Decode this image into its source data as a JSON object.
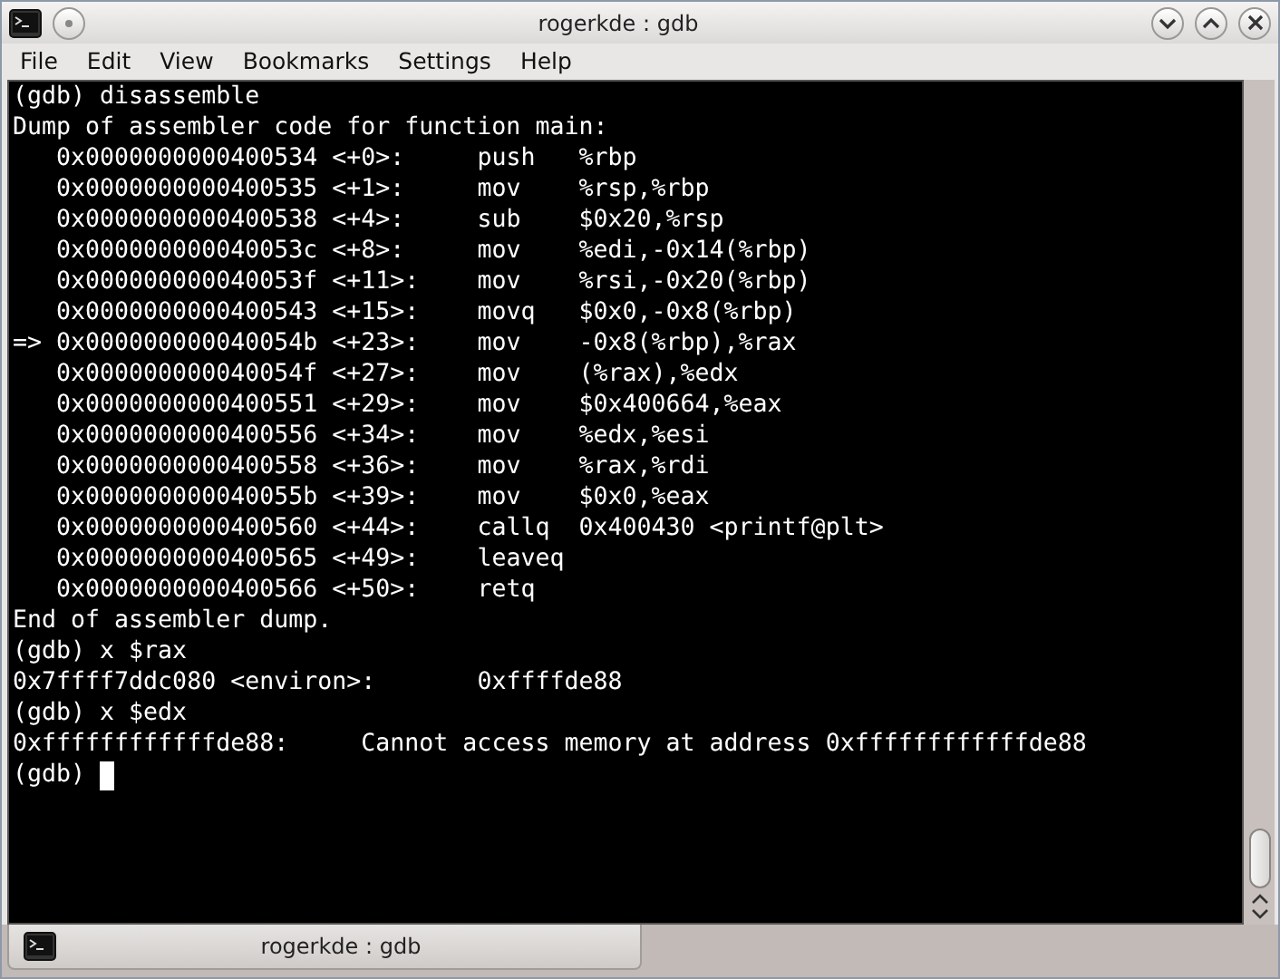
{
  "window": {
    "title": "rogerkde : gdb"
  },
  "menu": [
    "File",
    "Edit",
    "View",
    "Bookmarks",
    "Settings",
    "Help"
  ],
  "terminal": {
    "lines": [
      {
        "text": "(gdb) disassemble",
        "cursor": false
      },
      {
        "text": "Dump of assembler code for function main:",
        "cursor": false
      },
      {
        "text": "   0x0000000000400534 <+0>:\tpush   %rbp",
        "cursor": false
      },
      {
        "text": "   0x0000000000400535 <+1>:\tmov    %rsp,%rbp",
        "cursor": false
      },
      {
        "text": "   0x0000000000400538 <+4>:\tsub    $0x20,%rsp",
        "cursor": false
      },
      {
        "text": "   0x000000000040053c <+8>:\tmov    %edi,-0x14(%rbp)",
        "cursor": false
      },
      {
        "text": "   0x000000000040053f <+11>:\tmov    %rsi,-0x20(%rbp)",
        "cursor": false
      },
      {
        "text": "   0x0000000000400543 <+15>:\tmovq   $0x0,-0x8(%rbp)",
        "cursor": false
      },
      {
        "text": "=> 0x000000000040054b <+23>:\tmov    -0x8(%rbp),%rax",
        "cursor": false
      },
      {
        "text": "   0x000000000040054f <+27>:\tmov    (%rax),%edx",
        "cursor": false
      },
      {
        "text": "   0x0000000000400551 <+29>:\tmov    $0x400664,%eax",
        "cursor": false
      },
      {
        "text": "   0x0000000000400556 <+34>:\tmov    %edx,%esi",
        "cursor": false
      },
      {
        "text": "   0x0000000000400558 <+36>:\tmov    %rax,%rdi",
        "cursor": false
      },
      {
        "text": "   0x000000000040055b <+39>:\tmov    $0x0,%eax",
        "cursor": false
      },
      {
        "text": "   0x0000000000400560 <+44>:\tcallq  0x400430 <printf@plt>",
        "cursor": false
      },
      {
        "text": "   0x0000000000400565 <+49>:\tleaveq",
        "cursor": false
      },
      {
        "text": "   0x0000000000400566 <+50>:\tretq",
        "cursor": false
      },
      {
        "text": "End of assembler dump.",
        "cursor": false
      },
      {
        "text": "(gdb) x $rax",
        "cursor": false
      },
      {
        "text": "0x7ffff7ddc080 <environ>:\t0xffffde88",
        "cursor": false
      },
      {
        "text": "(gdb) x $edx",
        "cursor": false
      },
      {
        "text": "0xffffffffffffde88:\tCannot access memory at address 0xffffffffffffde88",
        "cursor": false
      },
      {
        "text": "(gdb)",
        "cursor": true
      }
    ]
  },
  "tabs": [
    {
      "label": "rogerkde : gdb",
      "selected": true
    }
  ]
}
